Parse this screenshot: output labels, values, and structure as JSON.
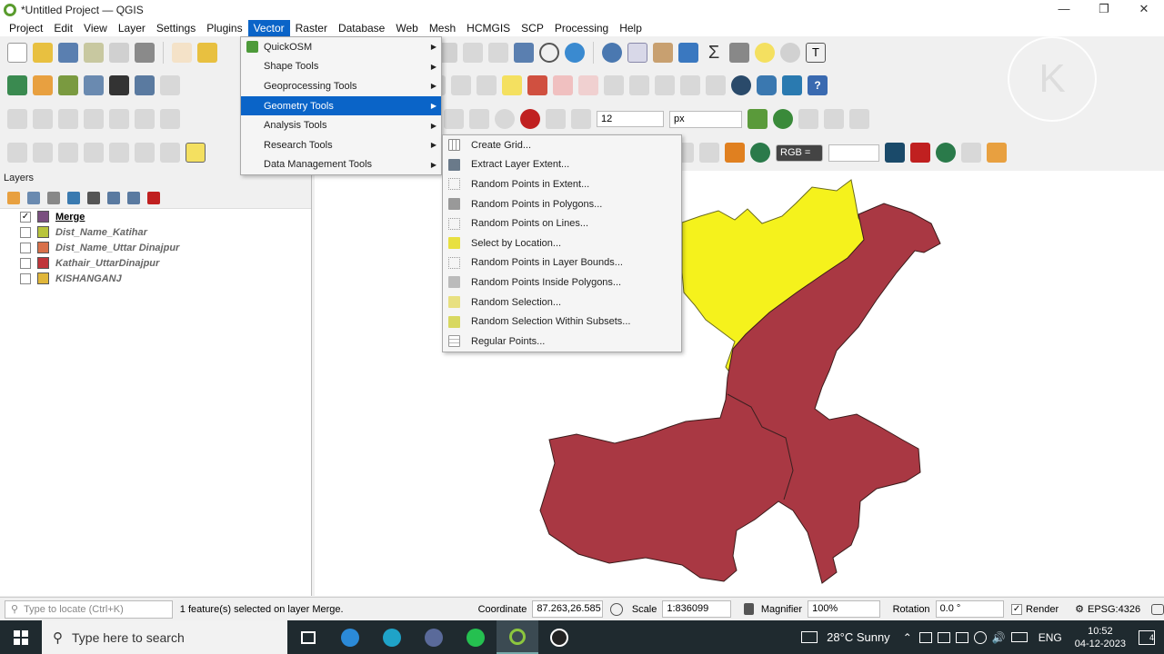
{
  "window": {
    "title": "*Untitled Project — QGIS"
  },
  "menubar": [
    "Project",
    "Edit",
    "View",
    "Layer",
    "Settings",
    "Plugins",
    "Vector",
    "Raster",
    "Database",
    "Web",
    "Mesh",
    "HCMGIS",
    "SCP",
    "Processing",
    "Help"
  ],
  "vector_menu": [
    {
      "label": "QuickOSM",
      "submenu": true
    },
    {
      "label": "Shape Tools",
      "submenu": true
    },
    {
      "label": "Geoprocessing Tools",
      "submenu": true
    },
    {
      "label": "Geometry Tools",
      "submenu": true,
      "highlighted": true
    },
    {
      "label": "Analysis Tools",
      "submenu": true
    },
    {
      "label": "Research Tools",
      "submenu": true
    },
    {
      "label": "Data Management Tools",
      "submenu": true
    }
  ],
  "geometry_menu": [
    "Create Grid...",
    "Extract Layer Extent...",
    "Random Points in Extent...",
    "Random Points in Polygons...",
    "Random Points on Lines...",
    "Select by Location...",
    "Random Points in Layer Bounds...",
    "Random Points Inside Polygons...",
    "Random Selection...",
    "Random Selection Within Subsets...",
    "Regular Points..."
  ],
  "layers_panel": {
    "title": "Layers",
    "layers": [
      {
        "name": "Merge",
        "checked": true,
        "color": "#7a4f7f"
      },
      {
        "name": "Dist_Name_Katihar",
        "checked": false,
        "color": "#b8c43c"
      },
      {
        "name": "Dist_Name_Uttar Dinajpur",
        "checked": false,
        "color": "#d8704a"
      },
      {
        "name": "Kathair_UttarDinajpur",
        "checked": false,
        "color": "#c0353a"
      },
      {
        "name": "KISHANGANJ",
        "checked": false,
        "color": "#e0b63a"
      }
    ]
  },
  "toolbar": {
    "font_size": "12",
    "unit": "px",
    "rgb_label": "RGB ="
  },
  "statusbar": {
    "locate_placeholder": "Type to locate (Ctrl+K)",
    "message": "1 feature(s) selected on layer Merge.",
    "coordinate_label": "Coordinate",
    "coordinate": "87.263,26.585",
    "scale_label": "Scale",
    "scale": "1:836099",
    "magnifier_label": "Magnifier",
    "magnifier": "100%",
    "rotation_label": "Rotation",
    "rotation": "0.0 °",
    "render_label": "Render",
    "crs": "EPSG:4326"
  },
  "taskbar": {
    "search_placeholder": "Type here to search",
    "weather": "28°C  Sunny",
    "lang": "ENG",
    "time": "10:52",
    "date": "04-12-2023",
    "notifications": "4"
  },
  "watermark": "K",
  "colors": {
    "map_red": "#a93843",
    "map_yellow": "#f5f21c",
    "accent": "#0a64c8"
  }
}
